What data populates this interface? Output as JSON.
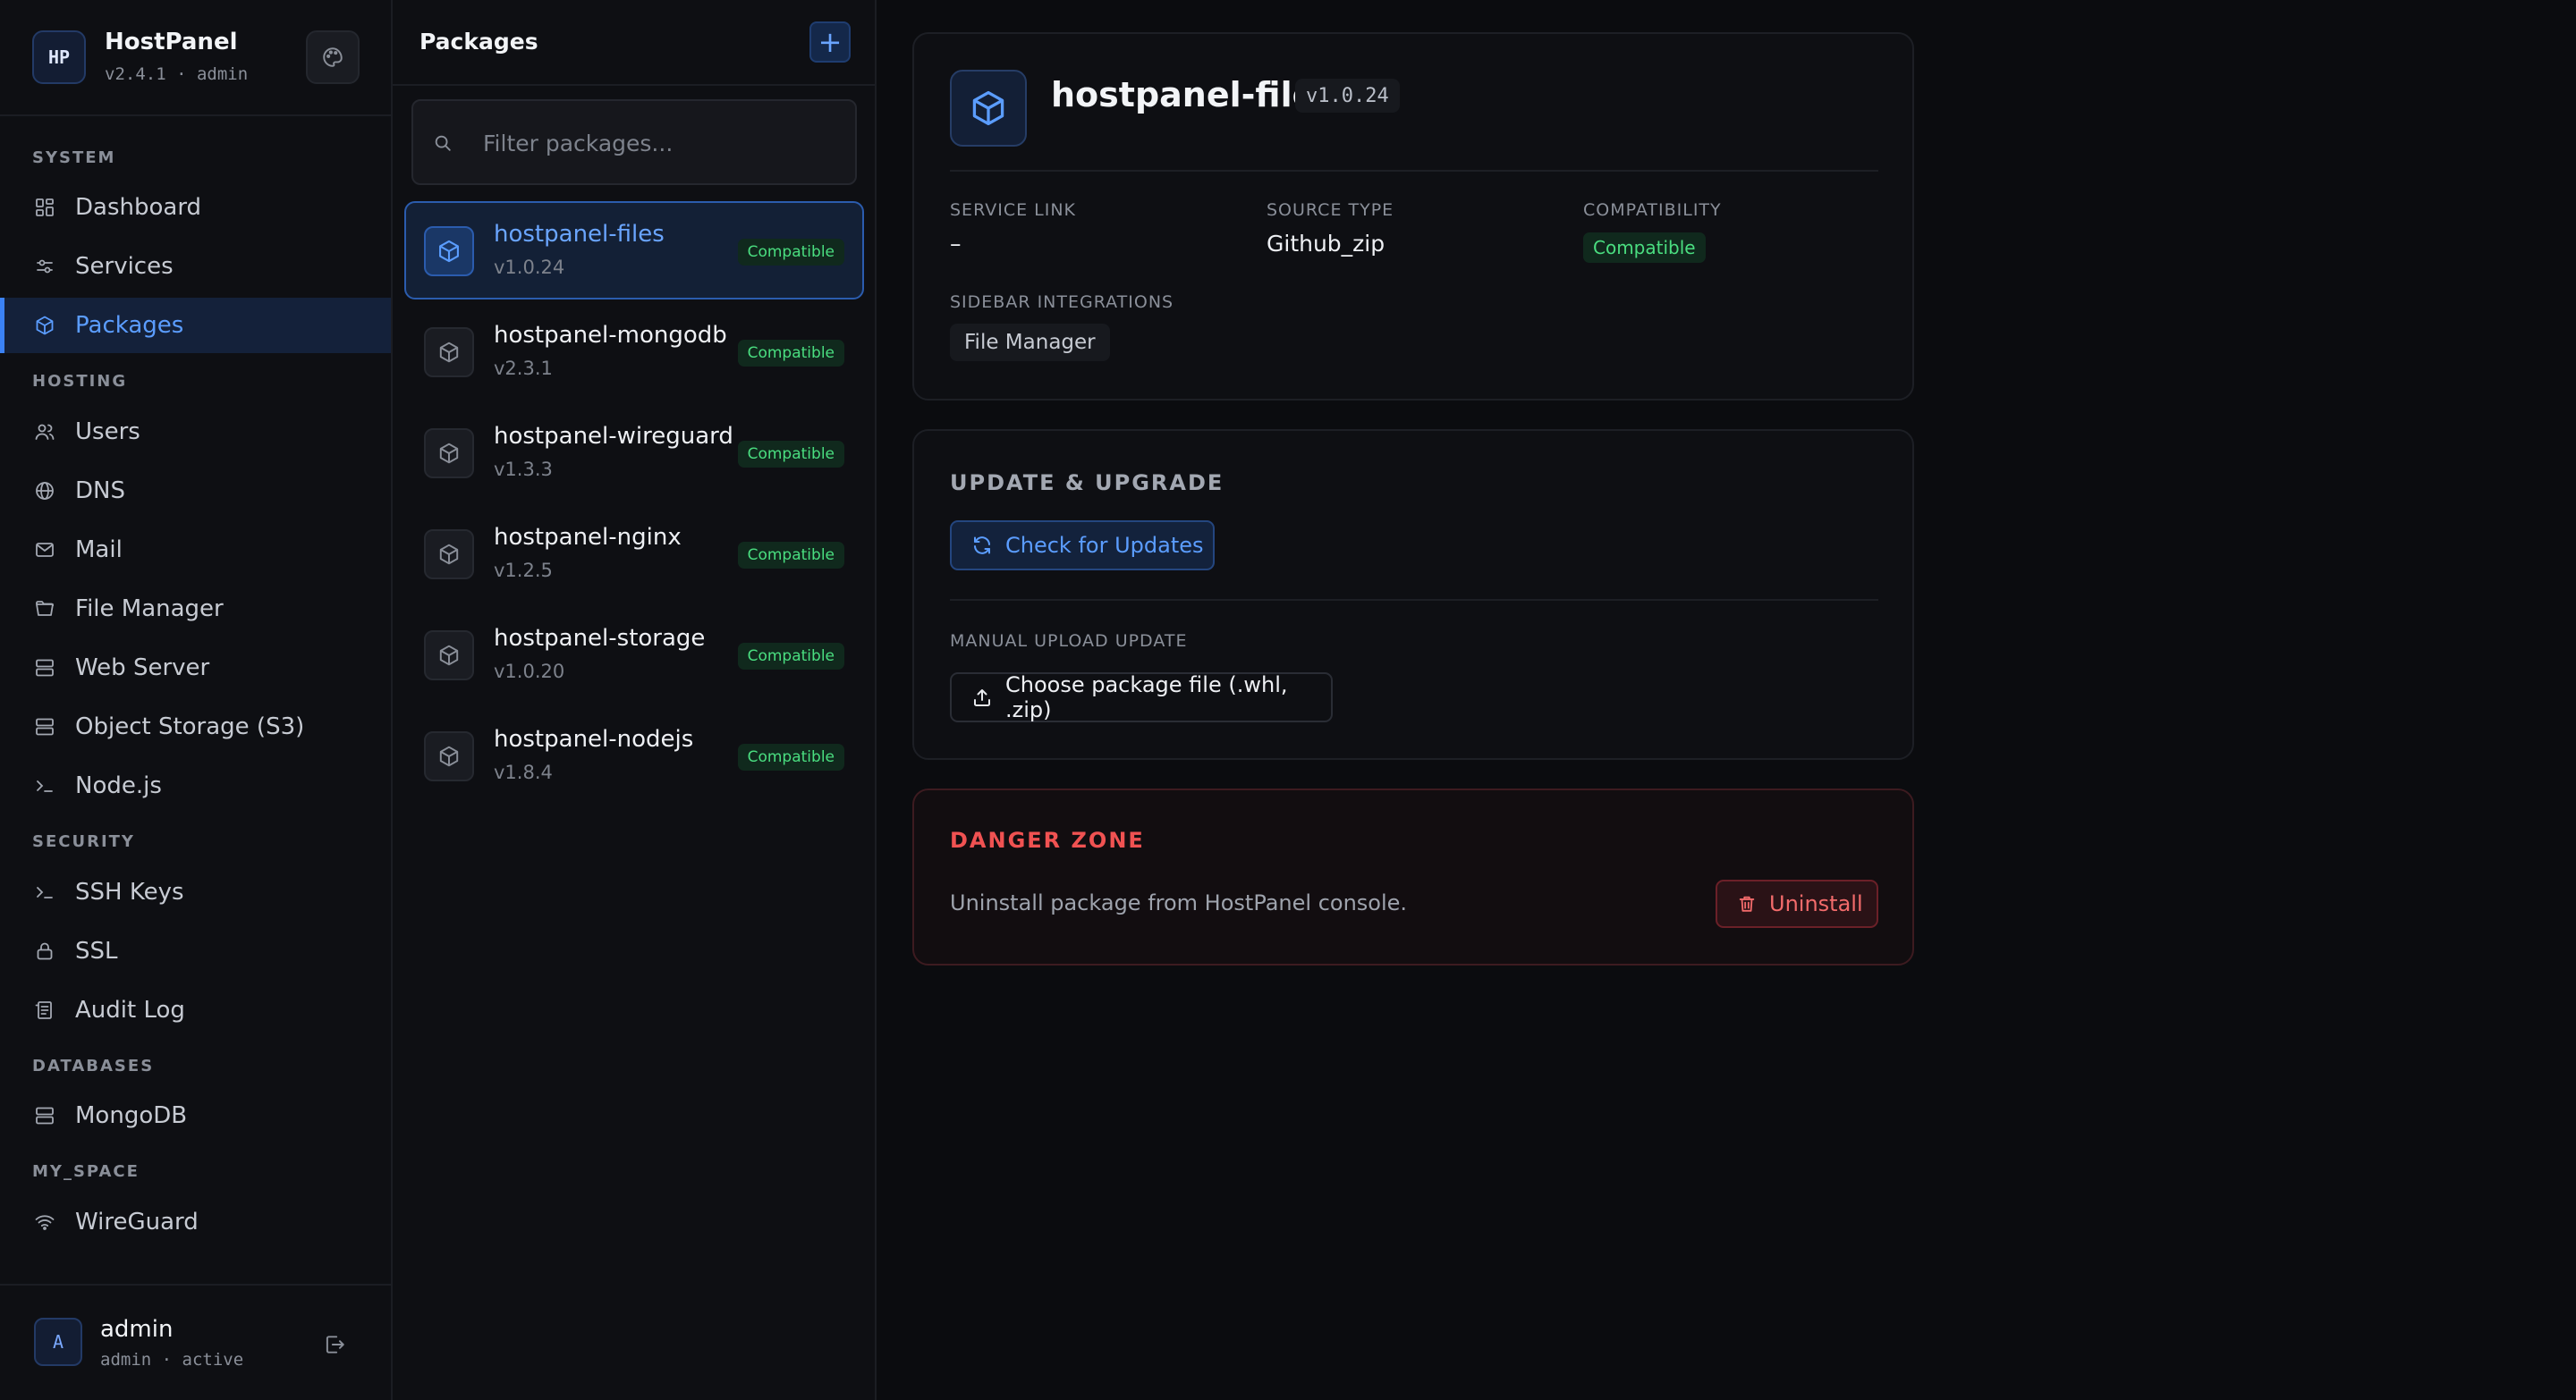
{
  "app": {
    "name": "HostPanel",
    "meta": "v2.4.1 · admin",
    "logo_text": "HP"
  },
  "nav": {
    "sections": [
      {
        "label": "SYSTEM",
        "items": [
          {
            "label": "Dashboard",
            "icon": "dashboard-icon"
          },
          {
            "label": "Services",
            "icon": "sliders-icon"
          },
          {
            "label": "Packages",
            "icon": "package-icon",
            "active": true
          }
        ]
      },
      {
        "label": "HOSTING",
        "items": [
          {
            "label": "Users",
            "icon": "users-icon"
          },
          {
            "label": "DNS",
            "icon": "globe-icon"
          },
          {
            "label": "Mail",
            "icon": "mail-icon"
          },
          {
            "label": "File Manager",
            "icon": "folder-icon"
          },
          {
            "label": "Web Server",
            "icon": "server-icon"
          },
          {
            "label": "Object Storage (S3)",
            "icon": "server-icon"
          },
          {
            "label": "Node.js",
            "icon": "terminal-icon"
          }
        ]
      },
      {
        "label": "SECURITY",
        "items": [
          {
            "label": "SSH Keys",
            "icon": "terminal-icon"
          },
          {
            "label": "SSL",
            "icon": "lock-icon"
          },
          {
            "label": "Audit Log",
            "icon": "log-icon"
          }
        ]
      },
      {
        "label": "DATABASES",
        "items": [
          {
            "label": "MongoDB",
            "icon": "server-icon"
          }
        ]
      },
      {
        "label": "MY_SPACE",
        "items": [
          {
            "label": "WireGuard",
            "icon": "wifi-icon"
          }
        ]
      }
    ]
  },
  "user": {
    "avatar": "A",
    "name": "admin",
    "status": "admin · active"
  },
  "packages_panel": {
    "title": "Packages",
    "add_label": "+",
    "filter_placeholder": "Filter packages...",
    "items": [
      {
        "name": "hostpanel-files",
        "version": "v1.0.24",
        "badge": "Compatible",
        "selected": true
      },
      {
        "name": "hostpanel-mongodb",
        "version": "v2.3.1",
        "badge": "Compatible"
      },
      {
        "name": "hostpanel-wireguard",
        "version": "v1.3.3",
        "badge": "Compatible"
      },
      {
        "name": "hostpanel-nginx",
        "version": "v1.2.5",
        "badge": "Compatible"
      },
      {
        "name": "hostpanel-storage",
        "version": "v1.0.20",
        "badge": "Compatible"
      },
      {
        "name": "hostpanel-nodejs",
        "version": "v1.8.4",
        "badge": "Compatible"
      }
    ]
  },
  "detail": {
    "name": "hostpanel-files",
    "version": "v1.0.24",
    "service_link_label": "SERVICE LINK",
    "service_link_value": "–",
    "source_type_label": "SOURCE TYPE",
    "source_type_value": "Github_zip",
    "compatibility_label": "COMPATIBILITY",
    "compatibility_value": "Compatible",
    "sidebar_integrations_label": "SIDEBAR INTEGRATIONS",
    "sidebar_integrations": [
      "File Manager"
    ]
  },
  "update": {
    "title": "UPDATE & UPGRADE",
    "check_label": "Check for Updates",
    "manual_label": "MANUAL UPLOAD UPDATE",
    "upload_label": "Choose package file (.whl, .zip)"
  },
  "danger": {
    "title": "DANGER ZONE",
    "text": "Uninstall package from HostPanel console.",
    "uninstall_label": "Uninstall"
  },
  "colors": {
    "accent": "#3b82f6",
    "success": "#4ade80",
    "danger": "#f05252",
    "background": "#0b0c0f"
  }
}
